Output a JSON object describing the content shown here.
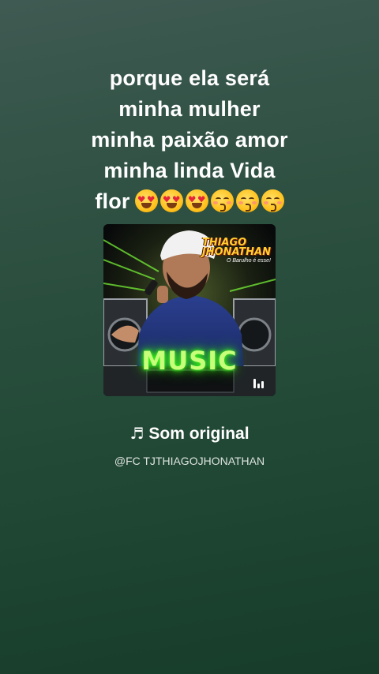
{
  "caption": {
    "lines": [
      "porque ela será",
      "minha mulher",
      "minha paixão amor",
      "minha linda Vida",
      "flor"
    ],
    "emojis": [
      "heart-eyes-emoji",
      "heart-eyes-emoji",
      "heart-eyes-emoji",
      "kissing-smiling-eyes-emoji",
      "kissing-smiling-eyes-emoji",
      "kissing-smiling-eyes-emoji"
    ]
  },
  "cover": {
    "artist_name_line1": "THIAGO",
    "artist_name_line2": "JHONATHAN",
    "artist_tagline": "O Barulho é esse!",
    "overlay_label": "MUSIC",
    "accent_color": "#39ff14",
    "icon": "audio-bars-icon"
  },
  "sound": {
    "icon": "music-note-icon",
    "note_glyph": "♬",
    "title": "Som original",
    "author": "@FC TJTHIAGOJHONATHAN"
  }
}
